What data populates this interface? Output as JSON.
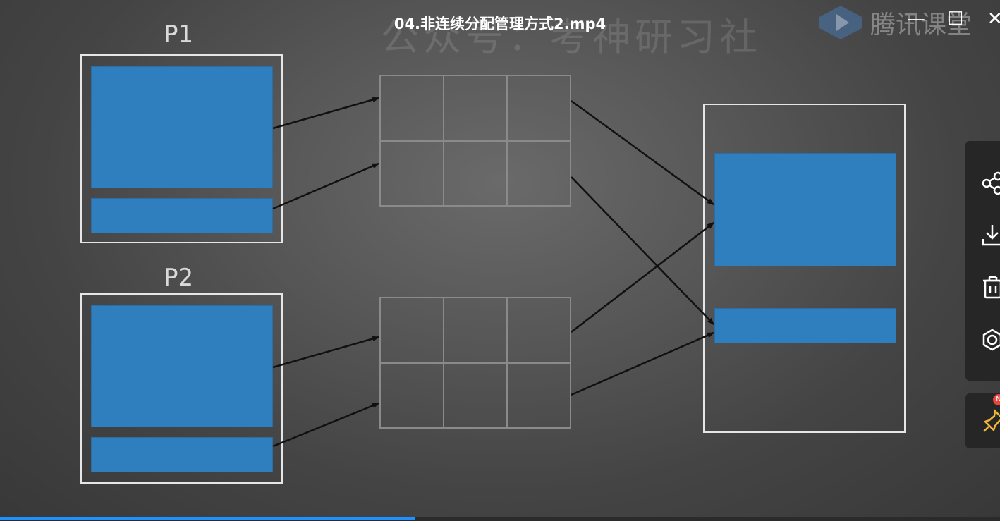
{
  "window": {
    "title": "04.非连续分配管理方式2.mp4",
    "minimize_glyph": "—",
    "maximize_glyph": "☐",
    "close_glyph": "✕"
  },
  "watermark": {
    "text": "公众号：考神研习社"
  },
  "brand": {
    "name": "腾讯课堂",
    "icon": "play-logo-icon"
  },
  "slide": {
    "process_labels": [
      "P1",
      "P2"
    ]
  },
  "side_toolbar": {
    "tools": [
      "share-icon",
      "download-icon",
      "delete-icon",
      "settings-icon"
    ],
    "pin_icon": "pin-icon",
    "pin_badge": "N"
  },
  "player": {
    "progress": 0.415
  },
  "colors": {
    "segment_blue": "#2f7fbf",
    "progress_blue": "#1e90ff",
    "panel_bg": "#262626"
  }
}
